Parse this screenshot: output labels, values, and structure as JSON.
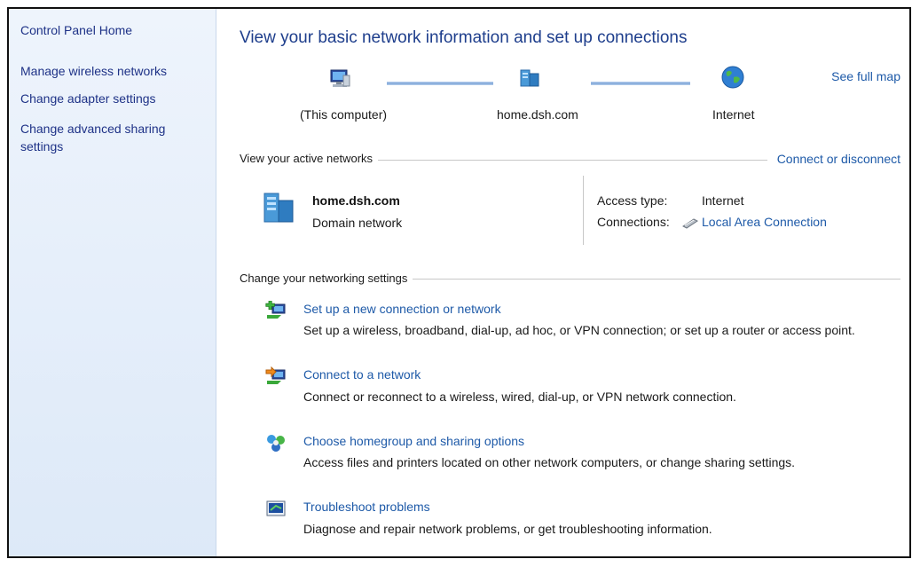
{
  "sidebar": {
    "home": "Control Panel Home",
    "items": [
      {
        "label": "Manage wireless networks"
      },
      {
        "label": "Change adapter settings"
      },
      {
        "label": "Change advanced sharing settings"
      }
    ]
  },
  "header": {
    "title": "View your basic network information and set up connections",
    "see_full_map": "See full map"
  },
  "map": {
    "computer_label": "(This computer)",
    "domain_label": "home.dsh.com",
    "internet_label": "Internet"
  },
  "active_networks": {
    "heading": "View your active networks",
    "connect_link": "Connect or disconnect",
    "network_name": "home.dsh.com",
    "network_type": "Domain network",
    "access_type_label": "Access type:",
    "access_type_value": "Internet",
    "connections_label": "Connections:",
    "connections_value": "Local Area Connection"
  },
  "settings": {
    "heading": "Change your networking settings",
    "tasks": [
      {
        "title": "Set up a new connection or network",
        "desc": "Set up a wireless, broadband, dial-up, ad hoc, or VPN connection; or set up a router or access point.",
        "icon": "new-connection-icon"
      },
      {
        "title": "Connect to a network",
        "desc": "Connect or reconnect to a wireless, wired, dial-up, or VPN network connection.",
        "icon": "connect-network-icon"
      },
      {
        "title": "Choose homegroup and sharing options",
        "desc": "Access files and printers located on other network computers, or change sharing settings.",
        "icon": "homegroup-icon"
      },
      {
        "title": "Troubleshoot problems",
        "desc": "Diagnose and repair network problems, or get troubleshooting information.",
        "icon": "troubleshoot-icon"
      }
    ]
  }
}
